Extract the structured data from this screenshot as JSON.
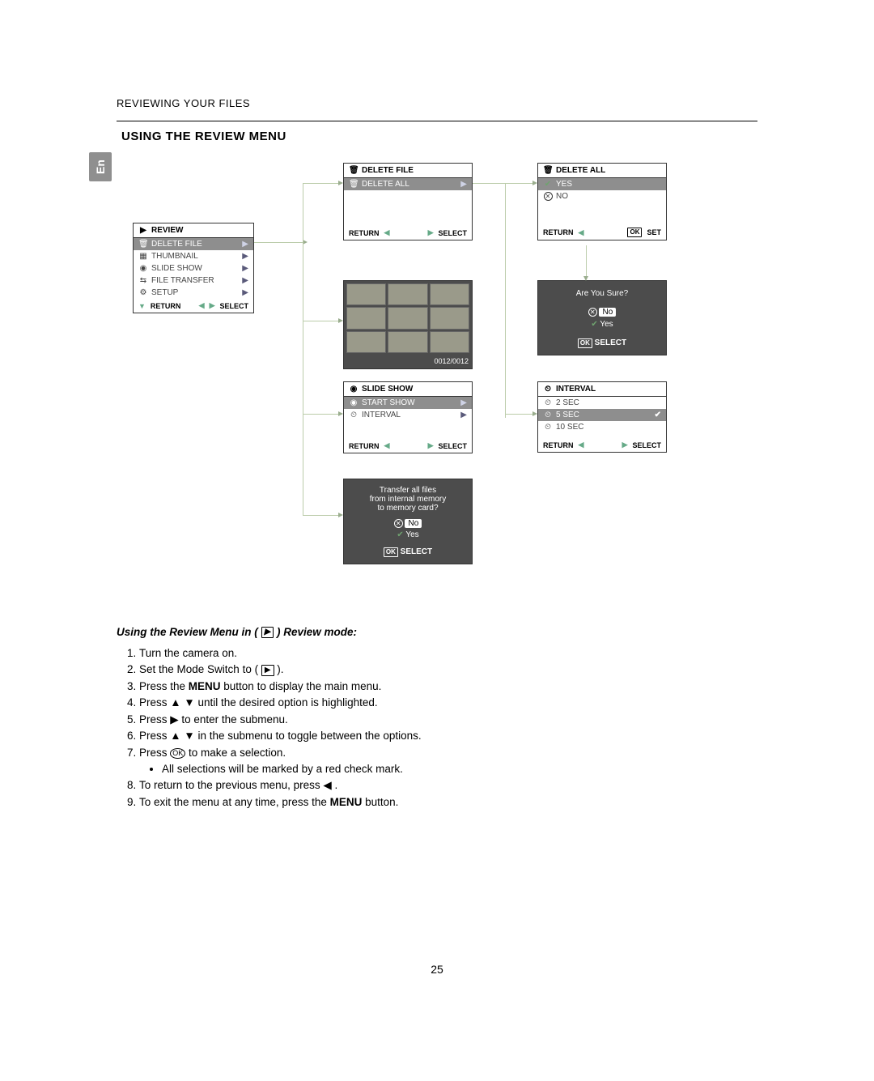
{
  "header": {
    "section": "REVIEWING YOUR FILES",
    "subsection": "USING THE REVIEW MENU",
    "lang_tab": "En"
  },
  "page_number": "25",
  "review_panel": {
    "title": "REVIEW",
    "items": [
      {
        "label": "DELETE FILE"
      },
      {
        "label": "THUMBNAIL"
      },
      {
        "label": "SLIDE SHOW"
      },
      {
        "label": "FILE TRANSFER"
      },
      {
        "label": "SETUP"
      }
    ],
    "foot_return": "RETURN",
    "foot_select": "SELECT"
  },
  "delete_file_panel": {
    "title": "DELETE FILE",
    "items": [
      {
        "label": "DELETE ALL"
      }
    ],
    "foot_return": "RETURN",
    "foot_select": "SELECT"
  },
  "delete_all_panel": {
    "title": "DELETE ALL",
    "items": [
      {
        "label": "YES"
      },
      {
        "label": "NO"
      }
    ],
    "foot_return": "RETURN",
    "foot_set": "SET"
  },
  "confirm_panel": {
    "prompt": "Are You Sure?",
    "no_label": "No",
    "yes_label": "Yes",
    "foot_select": "SELECT"
  },
  "thumbnail_panel": {
    "counter": "0012/0012"
  },
  "slide_show_panel": {
    "title": "SLIDE SHOW",
    "items": [
      {
        "label": "START SHOW"
      },
      {
        "label": "INTERVAL"
      }
    ],
    "foot_return": "RETURN",
    "foot_select": "SELECT"
  },
  "interval_panel": {
    "title": "INTERVAL",
    "items": [
      {
        "label": "2 SEC"
      },
      {
        "label": "5 SEC"
      },
      {
        "label": "10 SEC"
      }
    ],
    "foot_return": "RETURN",
    "foot_select": "SELECT"
  },
  "transfer_panel": {
    "line1": "Transfer all files",
    "line2": "from internal memory",
    "line3": "to memory card?",
    "no_label": "No",
    "yes_label": "Yes",
    "foot_select": "SELECT"
  },
  "instructions": {
    "heading_pre": "Using the Review Menu in  ( ",
    "heading_post": " ) Review mode:",
    "steps": [
      "Turn the camera on.",
      "Set the Mode Switch to ( ▶ ).",
      "Press the MENU button to display the main menu.",
      "Press ▲ ▼ until the desired option is highlighted.",
      "Press  ▶  to enter the submenu.",
      "Press ▲ ▼ in the submenu to toggle between the options.",
      "Press OK to make a selection.",
      "To return to the previous menu, press  ◀  .",
      "To exit the menu at any time, press the MENU button."
    ],
    "bullet": "All selections will be marked by a red check mark.",
    "s1": "Turn the camera on.",
    "s2_pre": "Set the Mode Switch to ( ",
    "s2_post": " ).",
    "s3_pre": "Press the ",
    "s3_bold": "MENU",
    "s3_post": " button to display the main menu.",
    "s4": "Press ▲ ▼ until the desired option is highlighted.",
    "s5": "Press  ▶  to enter the submenu.",
    "s6": "Press ▲ ▼ in the submenu to toggle between the options.",
    "s7_pre": "Press ",
    "s7_post": " to make a selection.",
    "s8": "To return to the previous menu, press  ◀  .",
    "s9_pre": "To exit the menu at any time, press the ",
    "s9_bold": "MENU",
    "s9_post": " button."
  }
}
